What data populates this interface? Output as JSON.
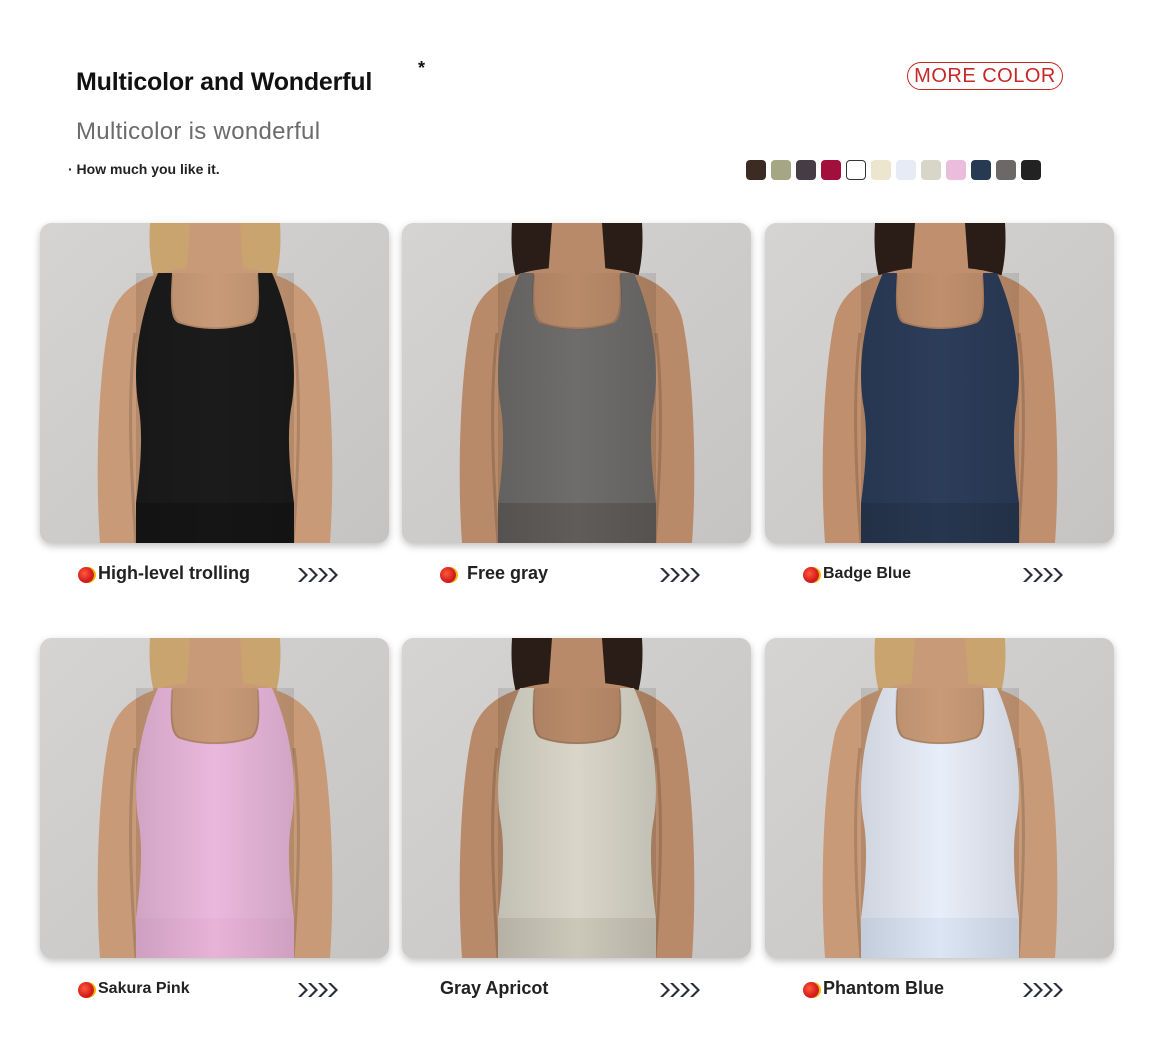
{
  "header": {
    "title": "Multicolor and Wonderful",
    "asterisk": "*",
    "subtitle": "Multicolor is wonderful",
    "tagline": "· How much you like it.",
    "more_color": "MORE COLOR"
  },
  "swatches": [
    "#3b2b22",
    "#a5a684",
    "#463c45",
    "#a30f3d",
    "#ffffff",
    "#ece6cf",
    "#e6ebf5",
    "#d8d6c8",
    "#ebbcdb",
    "#283a52",
    "#6b6867",
    "#222222"
  ],
  "cards": [
    {
      "label": "High-level trolling",
      "shirt": "#1b1b1b",
      "skin": "#c99a77",
      "hair": "#caa46f",
      "bottom": "#151515"
    },
    {
      "label": "Free gray",
      "shirt": "#6f6d6c",
      "skin": "#b88a69",
      "hair": "#2a1d17",
      "bottom": "#5f5c5a"
    },
    {
      "label": "Badge Blue",
      "shirt": "#2c3d5a",
      "skin": "#c08f6d",
      "hair": "#2a1d17",
      "bottom": "#27364f"
    },
    {
      "label": "Sakura Pink",
      "shirt": "#eab8dc",
      "skin": "#c99a77",
      "hair": "#caa46f",
      "bottom": "#e7b3d7"
    },
    {
      "label": "Gray Apricot",
      "shirt": "#d9d6c9",
      "skin": "#b88a69",
      "hair": "#2a1d17",
      "bottom": "#cbc7b9"
    },
    {
      "label": "Phantom Blue",
      "shirt": "#e8eef9",
      "skin": "#c99a77",
      "hair": "#caa46f",
      "bottom": "#dbe5f4"
    }
  ]
}
